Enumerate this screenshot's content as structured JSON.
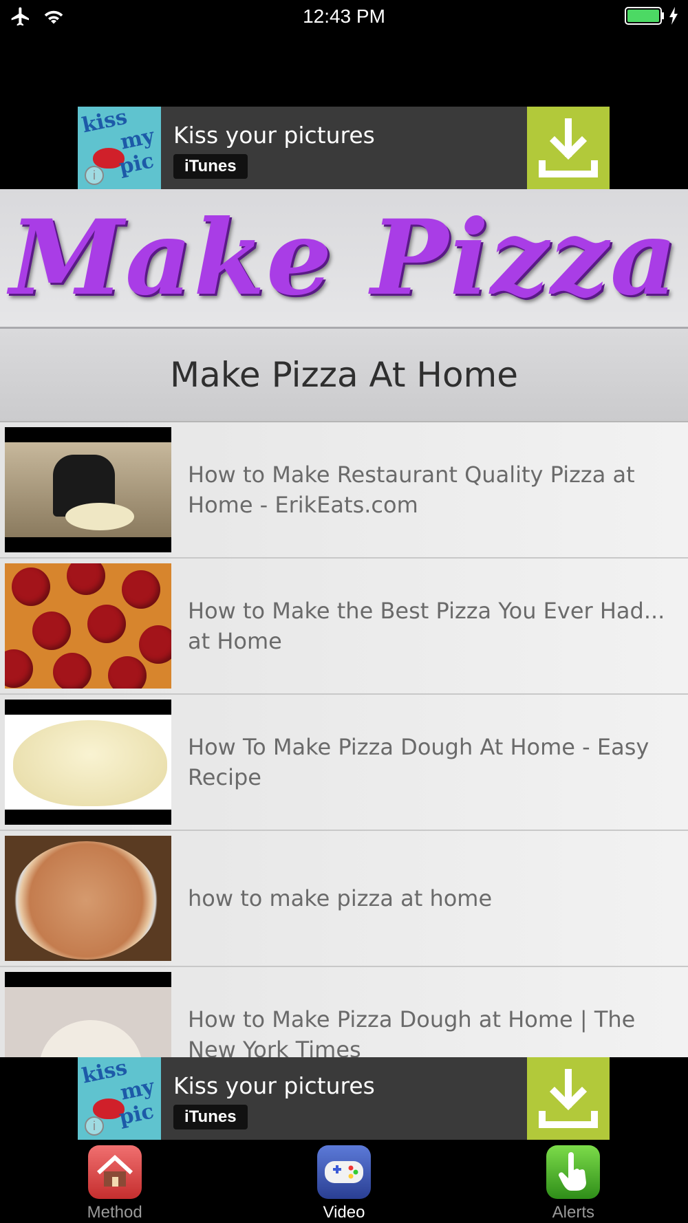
{
  "status_bar": {
    "time": "12:43 PM",
    "airplane_icon": "airplane-icon",
    "wifi_icon": "wifi-icon",
    "battery_icon": "battery-icon",
    "charging_icon": "lightning-icon"
  },
  "ad_top": {
    "logo_text": "kiss my pic",
    "title": "Kiss your pictures",
    "store": "iTunes",
    "download_icon": "download-icon",
    "accent_color": "#b2c93a"
  },
  "header": {
    "logo_text": "Make Pizza",
    "logo_color": "#a93de6"
  },
  "section": {
    "title": "Make Pizza At Home"
  },
  "videos": [
    {
      "title": "How to Make Restaurant Quality Pizza at Home - ErikEats.com"
    },
    {
      "title": "How to Make the Best Pizza You Ever Had... at Home"
    },
    {
      "title": "How To Make Pizza Dough At Home - Easy Recipe"
    },
    {
      "title": "how to make pizza at home"
    },
    {
      "title": "How to Make Pizza Dough at Home | The New York Times"
    }
  ],
  "ad_bottom": {
    "logo_text": "kiss my pic",
    "title": "Kiss your pictures",
    "store": "iTunes",
    "download_icon": "download-icon"
  },
  "tabs": [
    {
      "label": "Method",
      "icon": "home-icon",
      "active": false
    },
    {
      "label": "Video",
      "icon": "gamepad-icon",
      "active": true
    },
    {
      "label": "Alerts",
      "icon": "hand-pointer-icon",
      "active": false
    }
  ]
}
